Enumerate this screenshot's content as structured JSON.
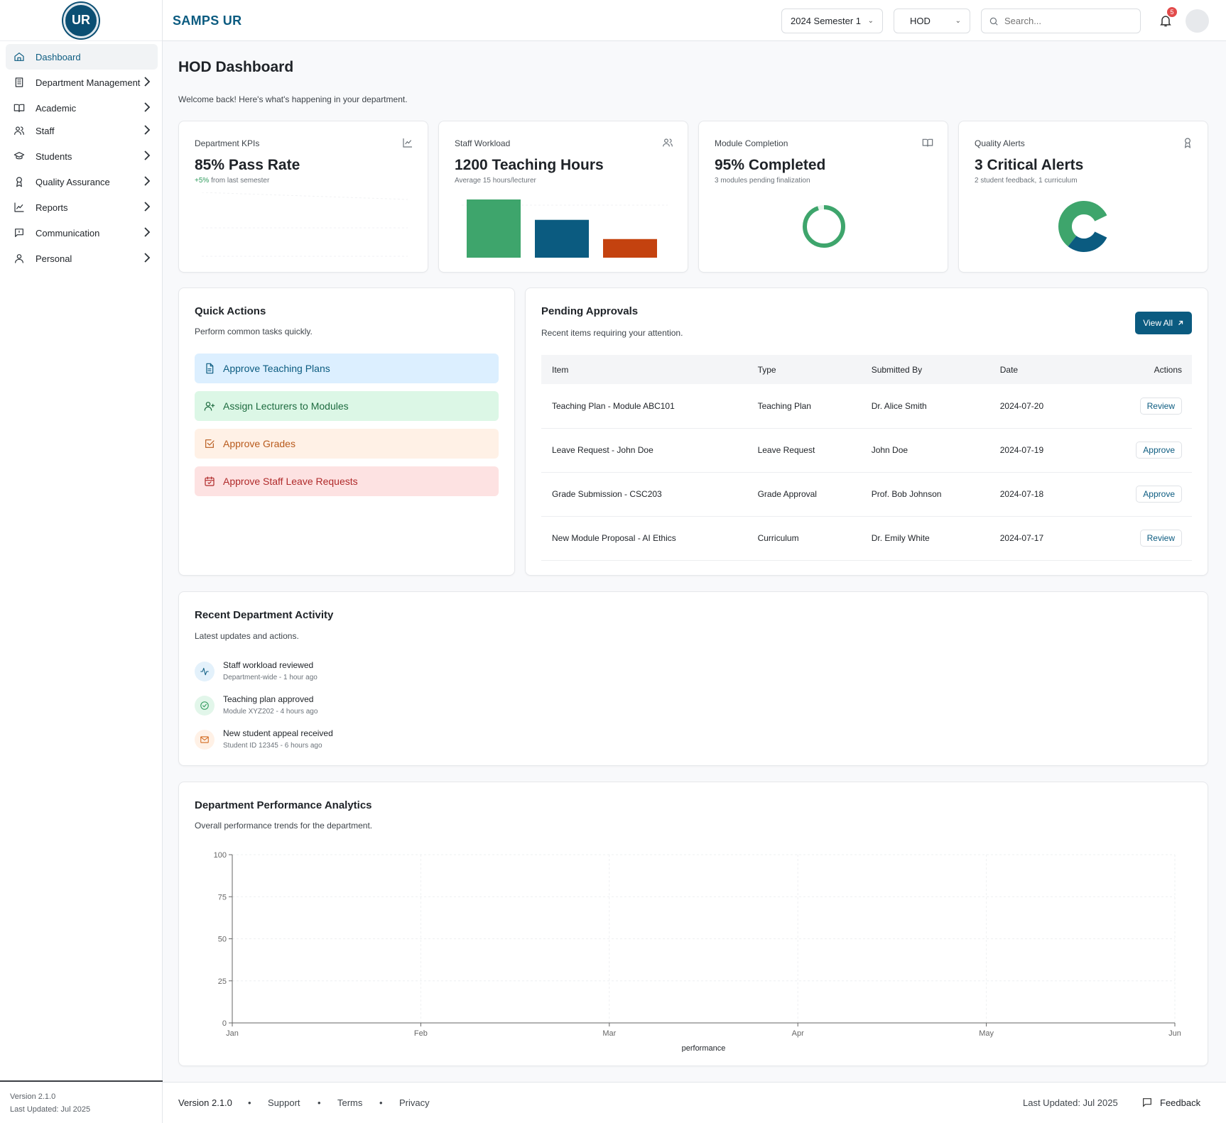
{
  "app": {
    "brand": "SAMPS UR",
    "logo_text": "UR"
  },
  "sidebar": {
    "items": [
      {
        "label": "Dashboard",
        "icon": "home-icon",
        "active": true
      },
      {
        "label": "Department Management",
        "icon": "building-icon"
      },
      {
        "label": "Academic",
        "icon": "book-icon"
      },
      {
        "label": "Staff",
        "icon": "users-icon"
      },
      {
        "label": "Students",
        "icon": "graduation-cap-icon"
      },
      {
        "label": "Quality Assurance",
        "icon": "award-icon"
      },
      {
        "label": "Reports",
        "icon": "line-chart-icon"
      },
      {
        "label": "Communication",
        "icon": "message-square-icon"
      },
      {
        "label": "Personal",
        "icon": "user-icon"
      }
    ],
    "footer": {
      "version": "Version 2.1.0",
      "updated": "Last Updated: Jul 2025"
    }
  },
  "header": {
    "semester": "2024 Semester 1",
    "role": "HOD",
    "search_placeholder": "Search...",
    "notifications": "5"
  },
  "page": {
    "title": "HOD Dashboard",
    "subtitle": "Welcome back! Here's what's happening in your department."
  },
  "kpis": [
    {
      "label": "Department KPIs",
      "value": "85% Pass Rate",
      "note_pos": "+5%",
      "note": " from last semester",
      "icon": "trend-chart-icon"
    },
    {
      "label": "Staff Workload",
      "value": "1200 Teaching Hours",
      "note": "Average 15 hours/lecturer",
      "icon": "users-icon"
    },
    {
      "label": "Module Completion",
      "value": "95% Completed",
      "note": "3 modules pending finalization",
      "icon": "book-open-icon"
    },
    {
      "label": "Quality Alerts",
      "value": "3 Critical Alerts",
      "note": "2 student feedback, 1 curriculum",
      "icon": "award-icon"
    }
  ],
  "workload_bars": [
    {
      "value": 1.0,
      "color": "#3ea56c"
    },
    {
      "value": 0.65,
      "color": "#0b5b80"
    },
    {
      "value": 0.32,
      "color": "#c4420f"
    }
  ],
  "module_completion_fraction": 0.95,
  "quality_alerts_split": [
    {
      "name": "student feedback",
      "value": 2,
      "color": "#3ea56c"
    },
    {
      "name": "curriculum",
      "value": 1,
      "color": "#0b5b80"
    }
  ],
  "quick_actions": {
    "title": "Quick Actions",
    "subtitle": "Perform common tasks quickly.",
    "items": [
      {
        "label": "Approve Teaching Plans",
        "icon": "file-text-icon",
        "bg": "#dcefff",
        "fg": "#0b5b80"
      },
      {
        "label": "Assign Lecturers to Modules",
        "icon": "user-plus-icon",
        "bg": "#dcf7e6",
        "fg": "#1d6b3f"
      },
      {
        "label": "Approve Grades",
        "icon": "check-square-icon",
        "bg": "#fff1e6",
        "fg": "#b85a1c"
      },
      {
        "label": "Approve Staff Leave Requests",
        "icon": "calendar-check-icon",
        "bg": "#fde2e2",
        "fg": "#b02a2a"
      }
    ]
  },
  "approvals": {
    "title": "Pending Approvals",
    "subtitle": "Recent items requiring your attention.",
    "view_all": "View All",
    "columns": [
      "Item",
      "Type",
      "Submitted By",
      "Date",
      "Actions"
    ],
    "rows": [
      {
        "item": "Teaching Plan - Module ABC101",
        "type": "Teaching Plan",
        "by": "Dr. Alice Smith",
        "date": "2024-07-20",
        "action": "Review"
      },
      {
        "item": "Leave Request - John Doe",
        "type": "Leave Request",
        "by": "John Doe",
        "date": "2024-07-19",
        "action": "Approve"
      },
      {
        "item": "Grade Submission - CSC203",
        "type": "Grade Approval",
        "by": "Prof. Bob Johnson",
        "date": "2024-07-18",
        "action": "Approve"
      },
      {
        "item": "New Module Proposal - AI Ethics",
        "type": "Curriculum",
        "by": "Dr. Emily White",
        "date": "2024-07-17",
        "action": "Review"
      }
    ]
  },
  "activity": {
    "title": "Recent Department Activity",
    "subtitle": "Latest updates and actions.",
    "items": [
      {
        "title": "Staff workload reviewed",
        "meta": "Department-wide - 1 hour ago",
        "icon": "activity-icon",
        "bg": "#e3f1fb",
        "fg": "#0b5b80"
      },
      {
        "title": "Teaching plan approved",
        "meta": "Module XYZ202 - 4 hours ago",
        "icon": "check-circle-icon",
        "bg": "#e2f6ea",
        "fg": "#2e9a5c"
      },
      {
        "title": "New student appeal received",
        "meta": "Student ID 12345 - 6 hours ago",
        "icon": "mail-icon",
        "bg": "#fff1e6",
        "fg": "#d2691e"
      }
    ]
  },
  "analytics": {
    "title": "Department Performance Analytics",
    "subtitle": "Overall performance trends for the department."
  },
  "chart_data": {
    "type": "line",
    "x": [
      "Jan",
      "Feb",
      "Mar",
      "Apr",
      "May",
      "Jun"
    ],
    "yticks": [
      0,
      25,
      50,
      75,
      100
    ],
    "ylim": [
      0,
      100
    ],
    "xlabel": "performance",
    "ylabel": "",
    "grid": true,
    "series": []
  },
  "footer": {
    "version": "Version 2.1.0",
    "links": [
      "Support",
      "Terms",
      "Privacy"
    ],
    "updated": "Last Updated: Jul 2025",
    "feedback": "Feedback"
  }
}
